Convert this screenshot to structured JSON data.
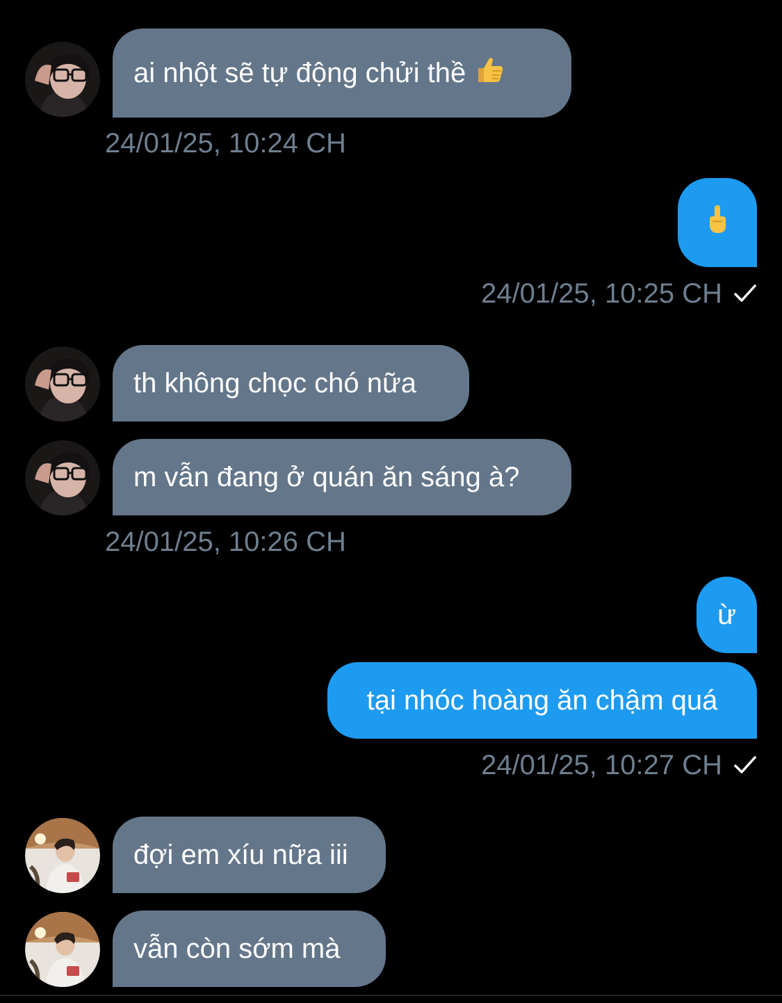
{
  "conversation": {
    "messages": [
      {
        "direction": "in",
        "text": "ai nhột sẽ tự động chửi thề",
        "emoji": "thumbs-up"
      },
      {
        "direction": "in",
        "text": "th không chọc chó nữa"
      },
      {
        "direction": "in",
        "text": "m vẫn đang ở quán ăn sáng à?"
      },
      {
        "direction": "out",
        "text": "ừ"
      },
      {
        "direction": "out",
        "text": "tại nhóc hoàng ăn chậm quá"
      },
      {
        "direction": "in",
        "text": "đợi em xíu nữa iii"
      },
      {
        "direction": "in",
        "text": "vẫn còn sớm mà"
      }
    ],
    "outgoing_emoji_message": {
      "emoji": "middle-finger"
    },
    "timestamps": [
      "24/01/25, 10:24 CH",
      "24/01/25, 10:25 CH",
      "24/01/25, 10:26 CH",
      "24/01/25, 10:27 CH"
    ]
  },
  "colors": {
    "background": "#000000",
    "incoming_bubble": "#64768a",
    "outgoing_bubble": "#1d9bf0",
    "timestamp_text": "#6e7f8f"
  },
  "icons": {
    "sent_status": "check-icon"
  }
}
